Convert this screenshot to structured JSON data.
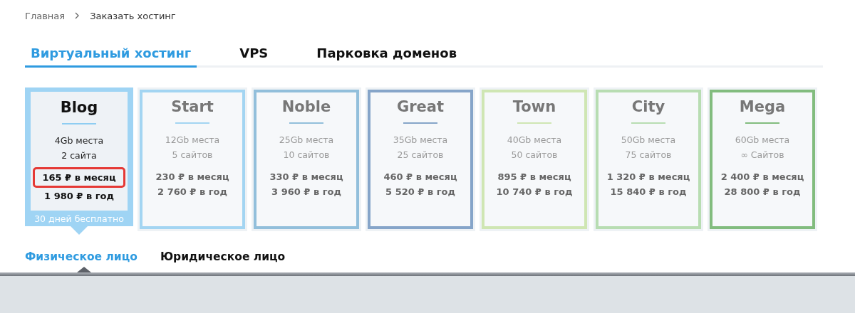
{
  "breadcrumbs": [
    {
      "label": "Главная"
    },
    {
      "label": "Заказать хостинг"
    }
  ],
  "tabs": [
    {
      "label": "Виртуальный хостинг",
      "selected": true
    },
    {
      "label": "VPS",
      "selected": false
    },
    {
      "label": "Парковка доменов",
      "selected": false
    }
  ],
  "plans": [
    {
      "name": "Blog",
      "color": "#9fd4f4",
      "space": "4Gb места",
      "sites": "2 сайта",
      "monthly": "165 ₽ в месяц",
      "yearly": "1 980 ₽ в год",
      "selected": true,
      "highlighted": true,
      "promo": "30 дней бесплатно"
    },
    {
      "name": "Start",
      "color": "#a3d5f2",
      "space": "12Gb места",
      "sites": "5 сайтов",
      "monthly": "230 ₽ в месяц",
      "yearly": "2 760 ₽ в год",
      "selected": false,
      "highlighted": false
    },
    {
      "name": "Noble",
      "color": "#92bfdb",
      "space": "25Gb места",
      "sites": "10 сайтов",
      "monthly": "330 ₽ в месяц",
      "yearly": "3 960 ₽ в год",
      "selected": false,
      "highlighted": false
    },
    {
      "name": "Great",
      "color": "#86a5c9",
      "space": "35Gb места",
      "sites": "25 сайтов",
      "monthly": "460 ₽ в месяц",
      "yearly": "5 520 ₽ в год",
      "selected": false,
      "highlighted": false
    },
    {
      "name": "Town",
      "color": "#cfe6b3",
      "space": "40Gb места",
      "sites": "50 сайтов",
      "monthly": "895 ₽ в месяц",
      "yearly": "10 740 ₽ в год",
      "selected": false,
      "highlighted": false
    },
    {
      "name": "City",
      "color": "#b8ddb2",
      "space": "50Gb места",
      "sites": "75 сайтов",
      "monthly": "1 320 ₽ в месяц",
      "yearly": "15 840 ₽ в год",
      "selected": false,
      "highlighted": false
    },
    {
      "name": "Mega",
      "color": "#82bc7e",
      "space": "60Gb места",
      "sites": "∞ Сайтов",
      "monthly": "2 400 ₽ в месяц",
      "yearly": "28 800 ₽ в год",
      "selected": false,
      "highlighted": false
    }
  ],
  "client_tabs": [
    {
      "label": "Физическое лицо",
      "selected": true
    },
    {
      "label": "Юридическое лицо",
      "selected": false
    }
  ]
}
